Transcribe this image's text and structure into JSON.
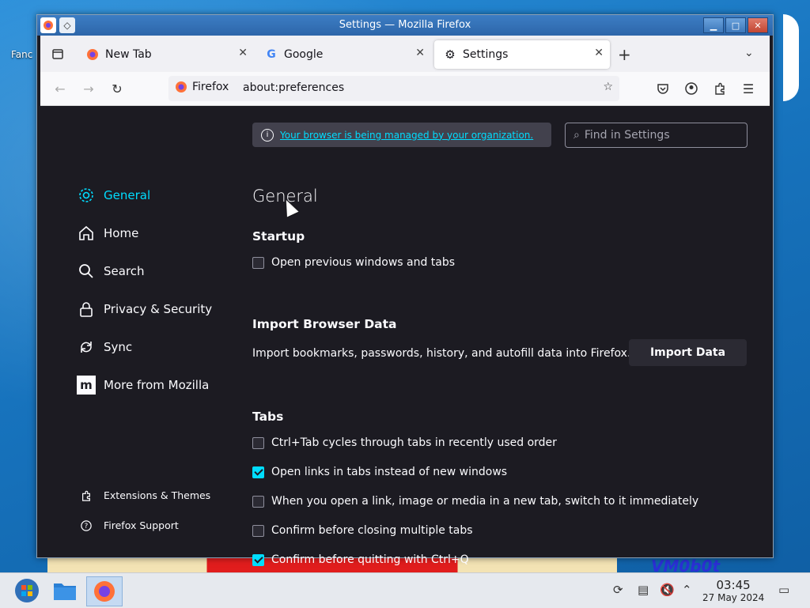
{
  "desktop": {
    "icon_label": "Fanc"
  },
  "window": {
    "title": "Settings — Mozilla Firefox"
  },
  "tabs": [
    {
      "label": "New Tab"
    },
    {
      "label": "Google"
    },
    {
      "label": "Settings"
    }
  ],
  "navbar": {
    "identity_label": "Firefox",
    "url": "about:preferences"
  },
  "settings": {
    "managed_notice": "Your browser is being managed by your organization.",
    "find_placeholder": "Find in Settings",
    "sidebar": {
      "items": [
        {
          "label": "General"
        },
        {
          "label": "Home"
        },
        {
          "label": "Search"
        },
        {
          "label": "Privacy & Security"
        },
        {
          "label": "Sync"
        },
        {
          "label": "More from Mozilla"
        }
      ],
      "footer": [
        {
          "label": "Extensions & Themes"
        },
        {
          "label": "Firefox Support"
        }
      ]
    },
    "page_title": "General",
    "startup": {
      "heading": "Startup",
      "open_previous": {
        "label": "Open previous windows and tabs",
        "checked": false
      }
    },
    "import": {
      "heading": "Import Browser Data",
      "description": "Import bookmarks, passwords, history, and autofill data into Firefox.",
      "button": "Import Data"
    },
    "tabs_section": {
      "heading": "Tabs",
      "options": [
        {
          "label": "Ctrl+Tab cycles through tabs in recently used order",
          "checked": false
        },
        {
          "label": "Open links in tabs instead of new windows",
          "checked": true
        },
        {
          "label": "When you open a link, image or media in a new tab, switch to it immediately",
          "checked": false
        },
        {
          "label": "Confirm before closing multiple tabs",
          "checked": false
        },
        {
          "label": "Confirm before quitting with Ctrl+Q",
          "checked": true
        }
      ]
    }
  },
  "taskbar": {
    "time": "03:45",
    "date": "27 May 2024"
  },
  "colors": {
    "accent": "#00ddff",
    "content_bg": "#1c1b22",
    "titlebar": "#3c7dc4"
  }
}
